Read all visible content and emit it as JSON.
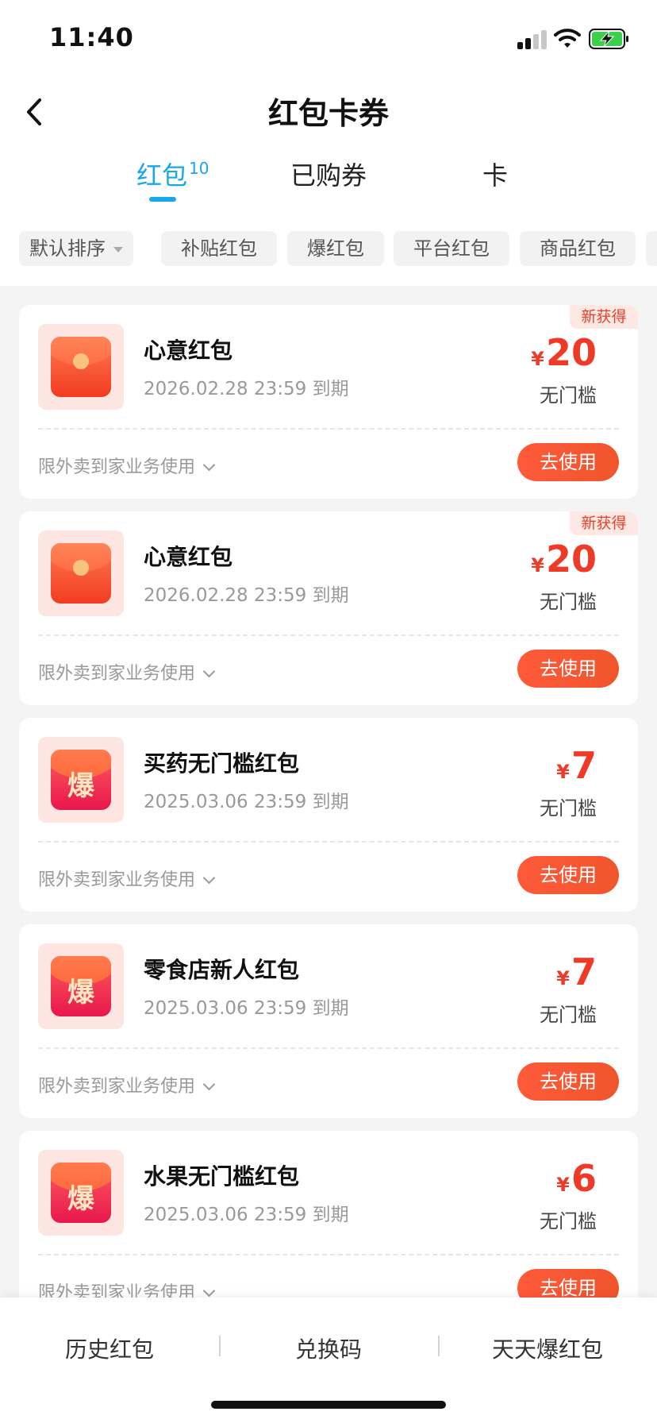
{
  "status_bar": {
    "time": "11:40"
  },
  "header": {
    "title": "红包卡券"
  },
  "tabs": [
    {
      "label": "红包",
      "badge": "10",
      "active": true
    },
    {
      "label": "已购券",
      "active": false
    },
    {
      "label": "卡",
      "active": false
    }
  ],
  "filters": [
    "默认排序",
    "补贴红包",
    "爆红包",
    "平台红包",
    "商品红包"
  ],
  "coupons": [
    {
      "icon": "red-envelope-icon",
      "title": "心意红包",
      "expiry": "2026.02.28 23:59 到期",
      "currency": "¥",
      "amount": "20",
      "threshold": "无门槛",
      "new_tag": "新获得",
      "limit": "限外卖到家业务使用",
      "action": "去使用"
    },
    {
      "icon": "red-envelope-icon",
      "title": "心意红包",
      "expiry": "2026.02.28 23:59 到期",
      "currency": "¥",
      "amount": "20",
      "threshold": "无门槛",
      "new_tag": "新获得",
      "limit": "限外卖到家业务使用",
      "action": "去使用"
    },
    {
      "icon": "bao-envelope-icon",
      "icon_glyph": "爆",
      "title": "买药无门槛红包",
      "expiry": "2025.03.06 23:59 到期",
      "currency": "¥",
      "amount": "7",
      "threshold": "无门槛",
      "limit": "限外卖到家业务使用",
      "action": "去使用"
    },
    {
      "icon": "bao-envelope-icon",
      "icon_glyph": "爆",
      "title": "零食店新人红包",
      "expiry": "2025.03.06 23:59 到期",
      "currency": "¥",
      "amount": "7",
      "threshold": "无门槛",
      "limit": "限外卖到家业务使用",
      "action": "去使用"
    },
    {
      "icon": "bao-envelope-icon",
      "icon_glyph": "爆",
      "title": "水果无门槛红包",
      "expiry": "2025.03.06 23:59 到期",
      "currency": "¥",
      "amount": "6",
      "threshold": "无门槛",
      "limit": "限外卖到家业务使用",
      "action": "去使用"
    }
  ],
  "bottom_bar": {
    "items": [
      "历史红包",
      "兑换码",
      "天天爆红包"
    ]
  },
  "colors": {
    "accent": "#1aa7e8",
    "price": "#ef3a28",
    "button": "#ff5a3a",
    "background": "#f4f4f4"
  }
}
